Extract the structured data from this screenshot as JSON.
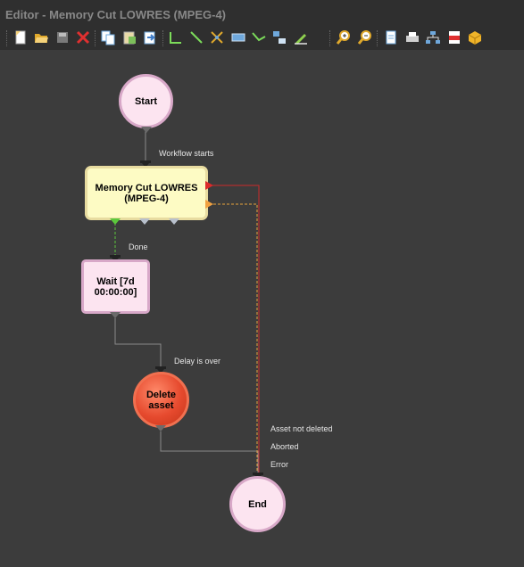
{
  "window": {
    "title": "Editor - Memory Cut LOWRES (MPEG-4)"
  },
  "toolbar": {
    "buttons": [
      {
        "name": "new-icon",
        "color": "#f5d27a"
      },
      {
        "name": "open-icon",
        "color": "#e0a92c"
      },
      {
        "name": "save-icon",
        "color": "#7a7a7a"
      },
      {
        "name": "delete-icon",
        "color": "#e03030"
      },
      {
        "name": "copy-icon",
        "color": "#6fa8dc"
      },
      {
        "name": "paste-icon",
        "color": "#7cbf5a"
      },
      {
        "name": "import-icon",
        "color": "#6fa8dc"
      },
      {
        "name": "orthogonal-connector-icon",
        "color": "#7cdc5a"
      },
      {
        "name": "straight-connector-icon",
        "color": "#7cdc5a"
      },
      {
        "name": "cut-connector-icon",
        "color": "#e0a92c"
      },
      {
        "name": "rectangle-icon",
        "color": "#6fa8dc"
      },
      {
        "name": "polyline-icon",
        "color": "#7cdc5a"
      },
      {
        "name": "align-icon",
        "color": "#6fa8dc"
      },
      {
        "name": "pen-icon",
        "color": "#8fd14f"
      },
      {
        "name": "zoom-in-icon",
        "color": "#e0a92c"
      },
      {
        "name": "zoom-out-icon",
        "color": "#e0a92c"
      },
      {
        "name": "page-icon",
        "color": "#6fa8dc"
      },
      {
        "name": "print-icon",
        "color": "#cfcfcf"
      },
      {
        "name": "hierarchy-icon",
        "color": "#6fa8dc"
      },
      {
        "name": "pdf-icon",
        "color": "#e03030"
      },
      {
        "name": "package-icon",
        "color": "#f0b429"
      }
    ]
  },
  "workflow": {
    "nodes": {
      "start": {
        "label": "Start"
      },
      "memory_cut": {
        "label": "Memory Cut LOWRES (MPEG-4)"
      },
      "wait": {
        "label": "Wait [7d 00:00:00]"
      },
      "delete_asset": {
        "label": "Delete asset"
      },
      "end": {
        "label": "End"
      }
    },
    "edges": {
      "workflow_starts": "Workflow starts",
      "done": "Done",
      "delay_is_over": "Delay is over",
      "asset_not_deleted": "Asset not deleted",
      "aborted": "Aborted",
      "error": "Error"
    },
    "colors": {
      "start_end_fill": "#fce4f0",
      "task_fill": "#fdfbc4",
      "wait_fill": "#fce4f0",
      "delete_fill": "#e64a2e",
      "error_wire": "#cc2a2a",
      "aborted_wire": "#e8a33c",
      "done_wire": "#5cc83c",
      "wire": "#8a8a8a"
    }
  }
}
